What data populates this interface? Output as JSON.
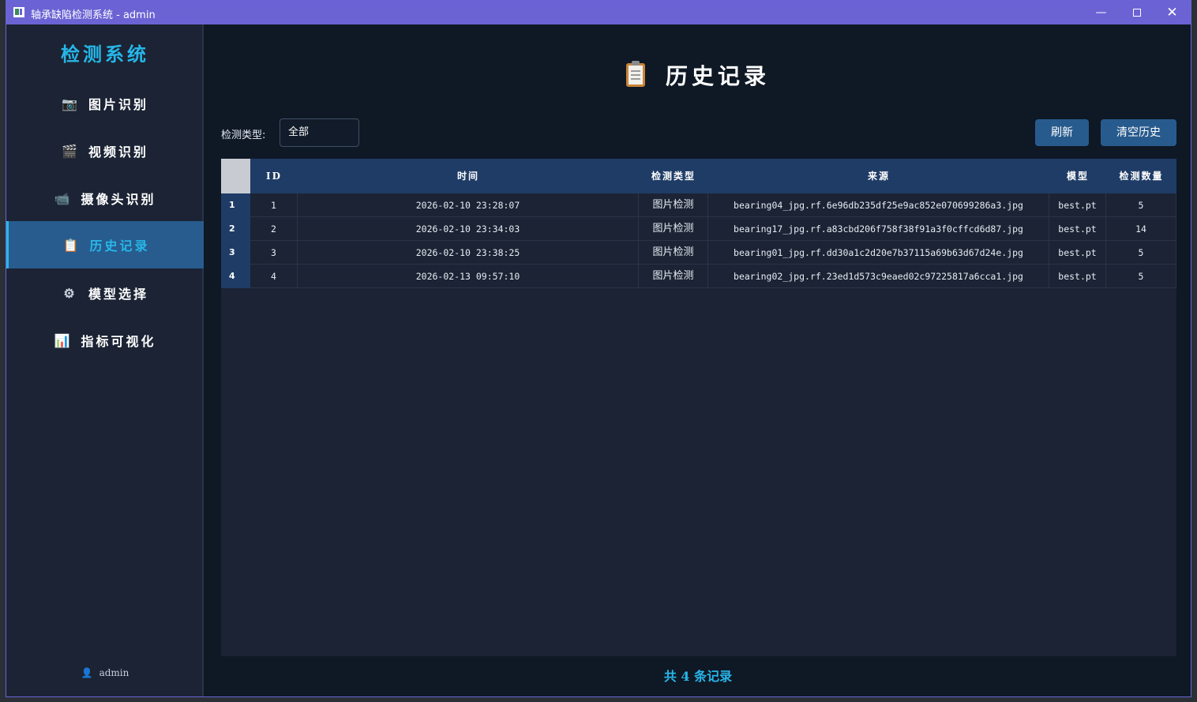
{
  "window": {
    "title": "轴承缺陷检测系统 - admin"
  },
  "sidebar": {
    "brand": "检测系统",
    "items": [
      {
        "label": "图片识别",
        "icon": "camera-icon",
        "glyph": "📷"
      },
      {
        "label": "视频识别",
        "icon": "clapperboard-icon",
        "glyph": "🎬"
      },
      {
        "label": "摄像头识别",
        "icon": "video-camera-icon",
        "glyph": "📹"
      },
      {
        "label": "历史记录",
        "icon": "clipboard-icon",
        "glyph": "📋"
      },
      {
        "label": "模型选择",
        "icon": "gear-icon",
        "glyph": "⚙"
      },
      {
        "label": "指标可视化",
        "icon": "bar-chart-icon",
        "glyph": "📊"
      }
    ],
    "active_index": 3,
    "user": "admin"
  },
  "main": {
    "title": "历史记录",
    "filter": {
      "label": "检测类型:",
      "value": "全部"
    },
    "buttons": {
      "refresh": "刷新",
      "clear": "清空历史"
    },
    "table": {
      "headers": [
        "ID",
        "时间",
        "检测类型",
        "来源",
        "模型",
        "检测数量"
      ],
      "rows": [
        {
          "num": "1",
          "id": "1",
          "time": "2026-02-10 23:28:07",
          "type": "图片检测",
          "source": "bearing04_jpg.rf.6e96db235df25e9ac852e070699286a3.jpg",
          "model": "best.pt",
          "count": "5"
        },
        {
          "num": "2",
          "id": "2",
          "time": "2026-02-10 23:34:03",
          "type": "图片检测",
          "source": "bearing17_jpg.rf.a83cbd206f758f38f91a3f0cffcd6d87.jpg",
          "model": "best.pt",
          "count": "14"
        },
        {
          "num": "3",
          "id": "3",
          "time": "2026-02-10 23:38:25",
          "type": "图片检测",
          "source": "bearing01_jpg.rf.dd30a1c2d20e7b37115a69b63d67d24e.jpg",
          "model": "best.pt",
          "count": "5"
        },
        {
          "num": "4",
          "id": "4",
          "time": "2026-02-13 09:57:10",
          "type": "图片检测",
          "source": "bearing02_jpg.rf.23ed1d573c9eaed02c97225817a6cca1.jpg",
          "model": "best.pt",
          "count": "5"
        }
      ]
    },
    "footer": "共 4 条记录"
  },
  "colors": {
    "titlebar": "#6b63d4",
    "accent": "#27b6e8",
    "active_item": "#285c8e",
    "button": "#285b8d",
    "table_header": "#1f3c66"
  }
}
